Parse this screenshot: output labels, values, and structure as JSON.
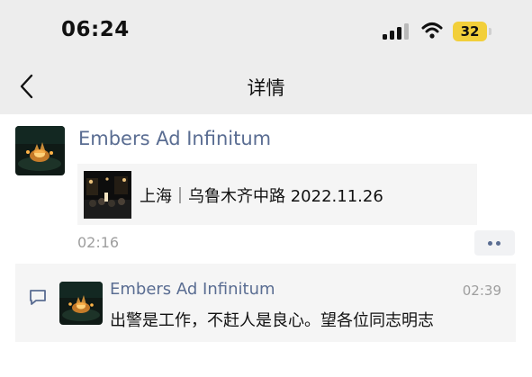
{
  "status_bar": {
    "time": "06:24",
    "battery": "32",
    "icons": [
      "cellular-signal-icon",
      "wifi-icon",
      "battery-icon"
    ]
  },
  "nav": {
    "title": "详情",
    "back_icon": "chevron-left-icon"
  },
  "post": {
    "author": "Embers Ad Infinitum",
    "link_title": "上海｜乌鲁木齐中路 2022.11.26",
    "time": "02:16",
    "more_icon": "more-dots-icon"
  },
  "comment": {
    "icon": "comment-icon",
    "author": "Embers Ad Infinitum",
    "time": "02:39",
    "text": "出警是工作，不赶人是良心。望各位同志明志"
  },
  "colors": {
    "top_background": "#ededed",
    "name_accent": "#5a6d92",
    "card_background": "#f5f5f5",
    "battery": "#f2cf3a",
    "secondary_text": "#9e9e9e"
  }
}
